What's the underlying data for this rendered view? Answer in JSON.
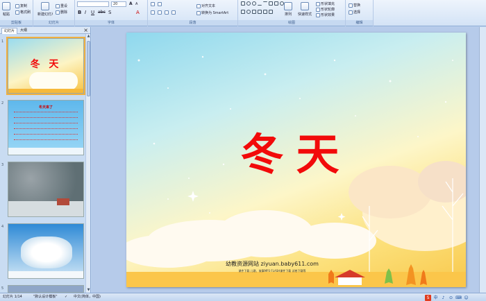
{
  "ribbon": {
    "clipboard": {
      "group_label": "剪贴板",
      "paste_label": "粘贴",
      "copy_label": "复制",
      "format_painter_label": "格式刷"
    },
    "slides": {
      "group_label": "幻灯片",
      "new_slide_label": "新建幻灯片",
      "reset_label": "重设",
      "delete_label": "删除"
    },
    "font": {
      "group_label": "字体",
      "font_size": "20"
    },
    "paragraph": {
      "group_label": "段落",
      "align_text_label": "对齐文本",
      "smartart_label": "转换为 SmartArt"
    },
    "drawing": {
      "group_label": "绘图",
      "arrange_label": "排列",
      "quick_styles_label": "快速样式",
      "shape_fill_label": "形状填充",
      "shape_outline_label": "形状轮廓",
      "shape_effects_label": "形状效果"
    },
    "editing": {
      "group_label": "编辑",
      "replace_label": "替换",
      "select_label": "选择"
    }
  },
  "pane": {
    "tabs": [
      {
        "label": "幻灯片"
      },
      {
        "label": "大纲"
      }
    ],
    "close_glyph": "×",
    "thumbnails": [
      {
        "num": "1",
        "title": "冬 天"
      },
      {
        "num": "2",
        "title": "冬天来了"
      },
      {
        "num": "3"
      },
      {
        "num": "4"
      },
      {
        "num": "5"
      }
    ]
  },
  "slide": {
    "title": "冬天",
    "site_name": "幼教资源网站  ziyuan.baby611.com",
    "site_sub": "课件下载  儿歌、故事MP3  FLASH课件下载  试卷下载等"
  },
  "status": {
    "slide_count": "幻灯片 1/14",
    "theme": "\"默认设计模板\"",
    "language": "中文(简体，中国)",
    "ime": [
      "S",
      "中",
      "♪",
      "⊙",
      "⌨",
      "☺"
    ]
  },
  "colors": {
    "title_red": "#f20a0a",
    "ribbon_bg": "#d3e3f6",
    "selection": "#f0b040"
  }
}
